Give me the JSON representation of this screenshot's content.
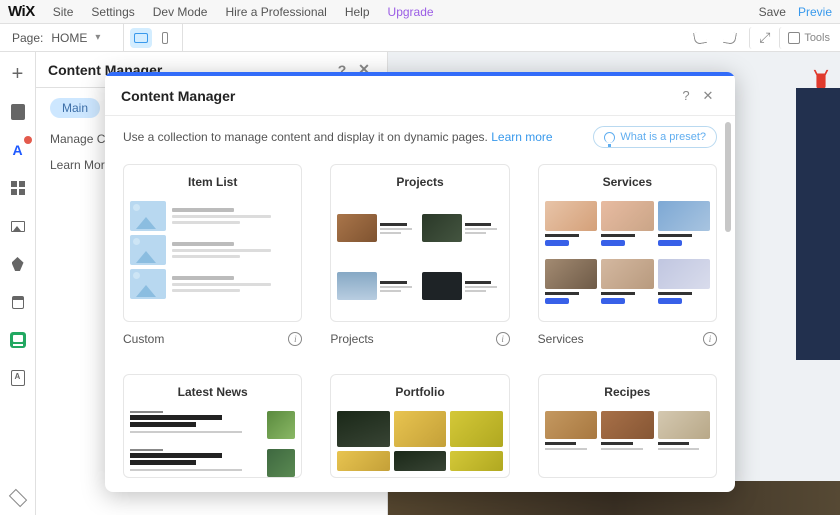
{
  "topbar": {
    "logo": "WiX",
    "menu": {
      "site": "Site",
      "settings": "Settings",
      "devmode": "Dev Mode",
      "hire": "Hire a Professional",
      "help": "Help",
      "upgrade": "Upgrade"
    },
    "right": {
      "save": "Save",
      "preview": "Previe"
    }
  },
  "subbar": {
    "page_label": "Page:",
    "page_name": "HOME",
    "tools": "Tools"
  },
  "panel1": {
    "title": "Content Manager",
    "pill": "Main",
    "links": {
      "manage": "Manage Content",
      "learn": "Learn More"
    }
  },
  "modal": {
    "title": "Content Manager",
    "intro": "Use a collection to manage content and display it on dynamic pages.",
    "learn": "Learn more",
    "preset_btn": "What is a preset?",
    "sections": [
      {
        "caption": "Custom",
        "card": "Item List"
      },
      {
        "caption": "Projects",
        "card": "Projects"
      },
      {
        "caption": "Services",
        "card": "Services"
      }
    ],
    "row2": [
      {
        "card": "Latest News"
      },
      {
        "card": "Portfolio"
      },
      {
        "card": "Recipes"
      }
    ]
  }
}
